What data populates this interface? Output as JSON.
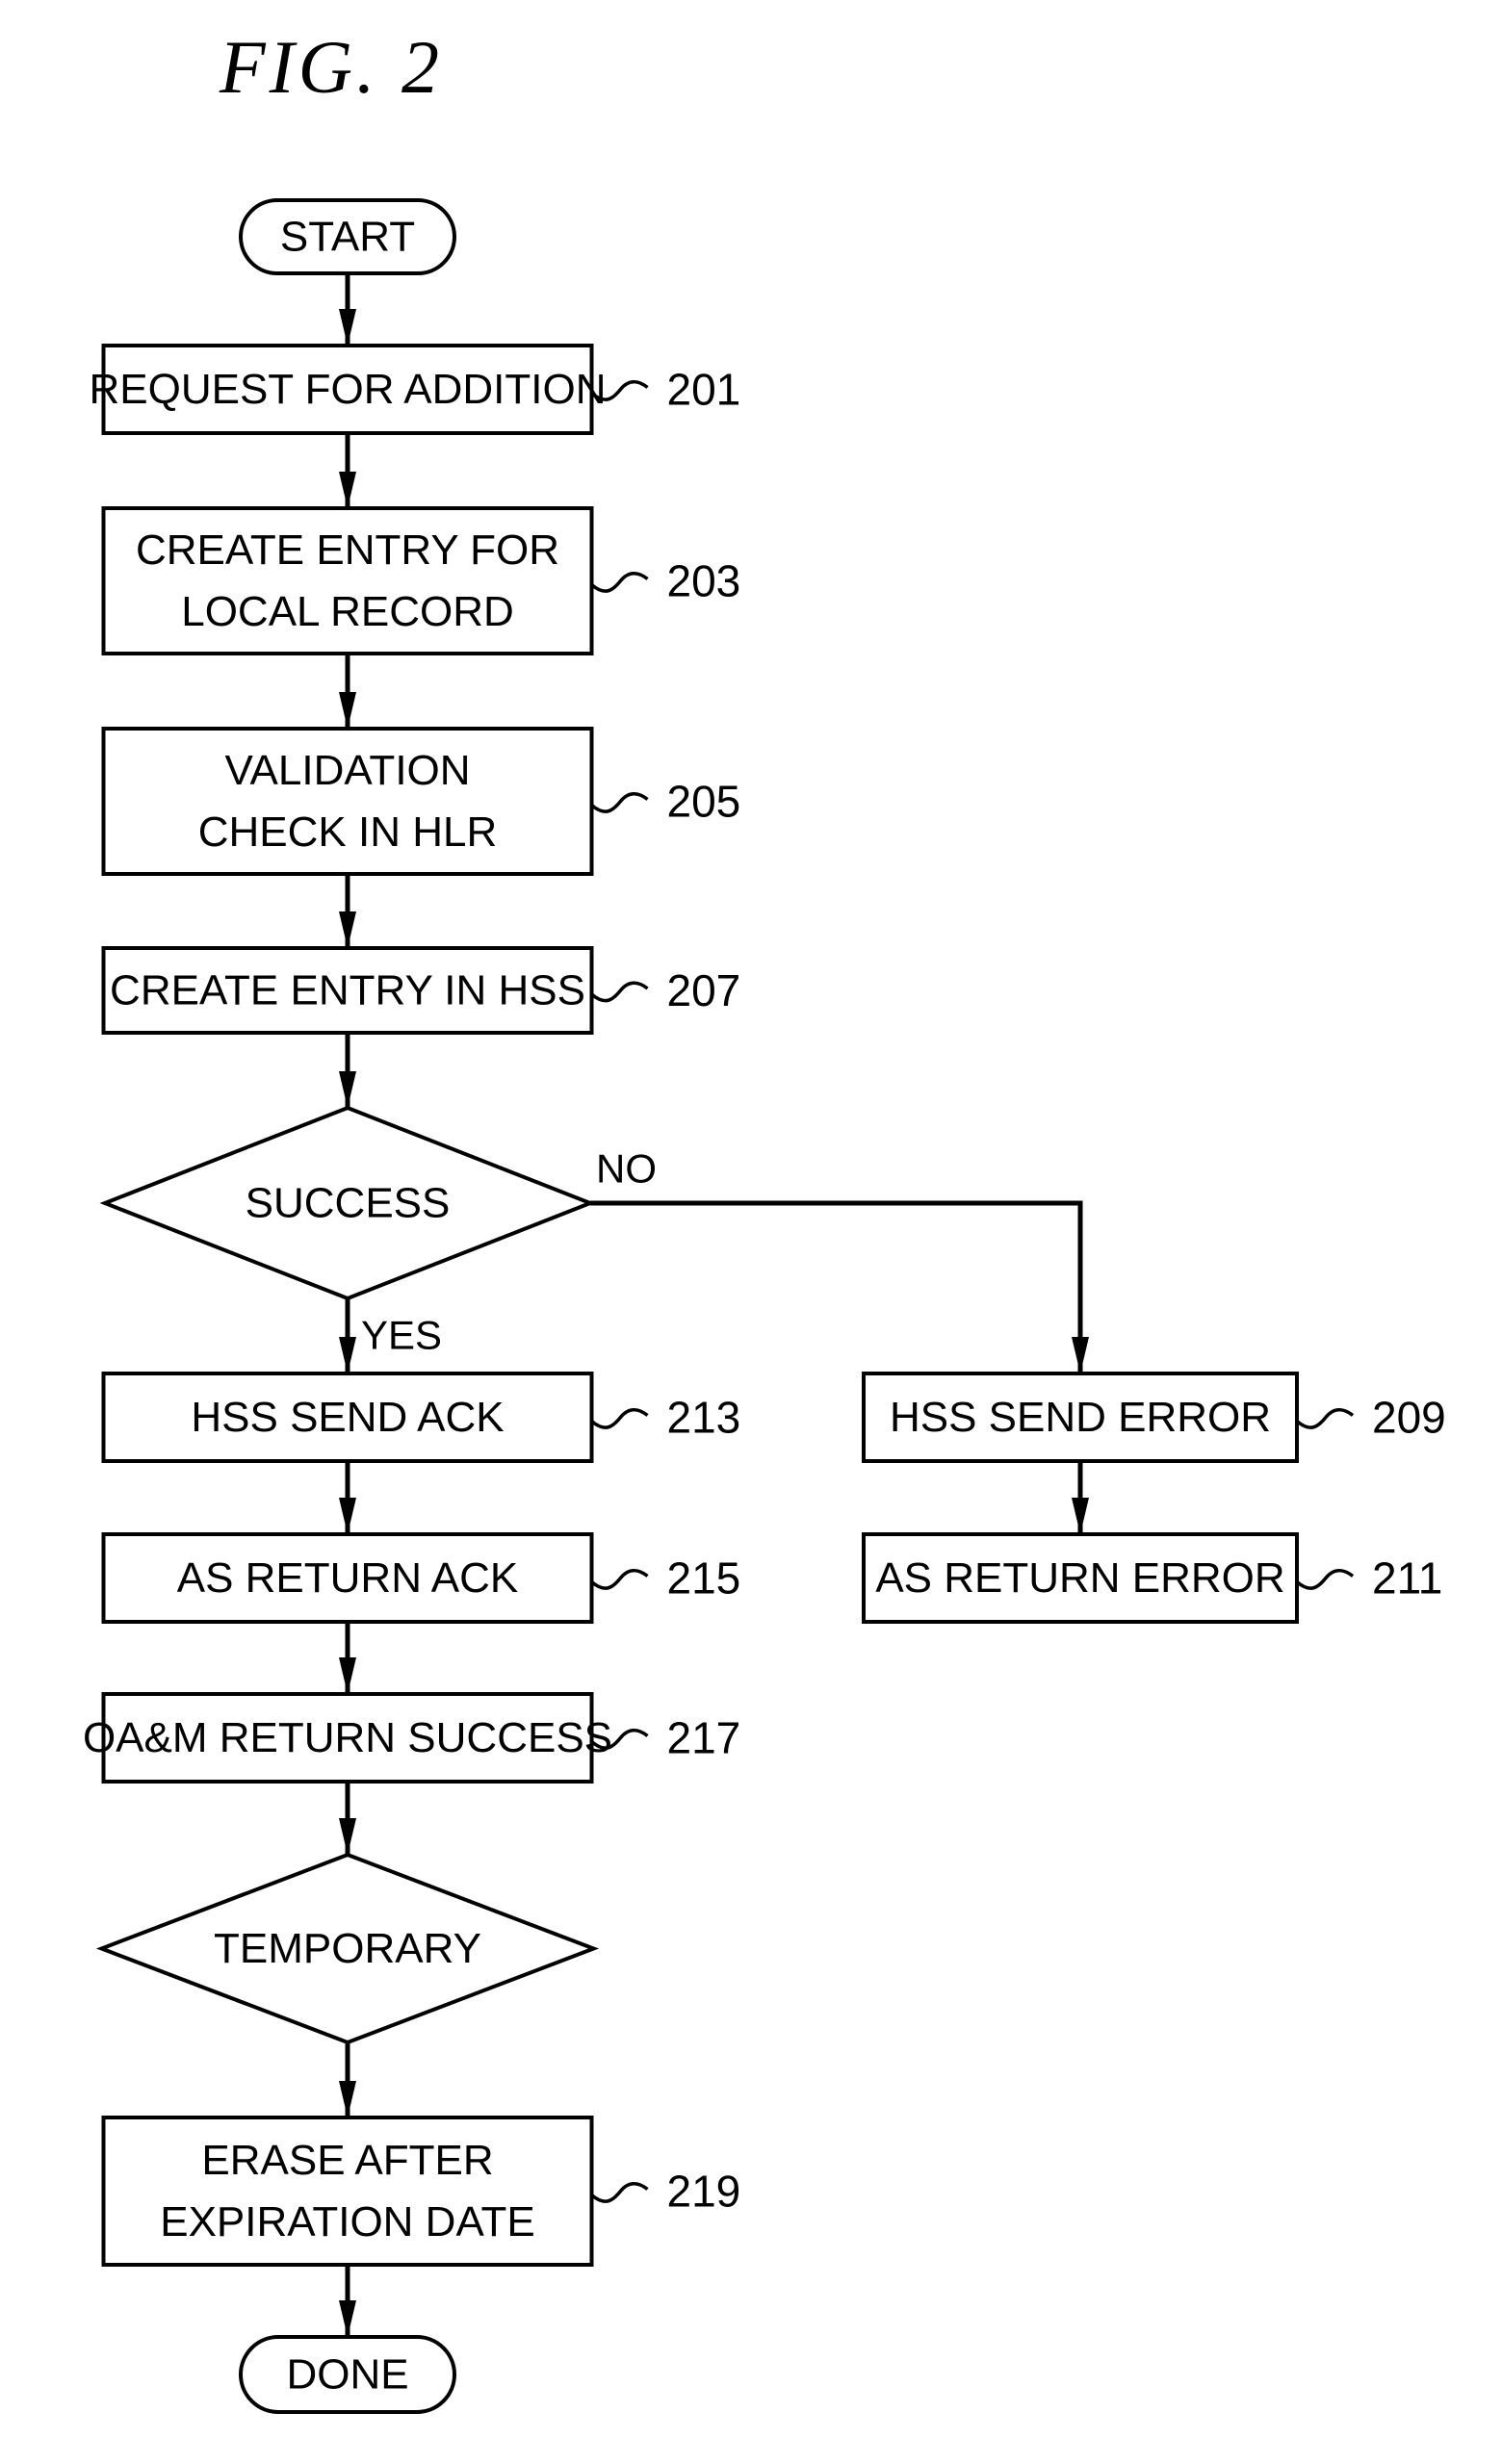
{
  "figure": {
    "title": "FIG. 2"
  },
  "nodes": [
    {
      "id": "start",
      "type": "terminal",
      "lines": [
        "START"
      ],
      "ref": ""
    },
    {
      "id": "n201",
      "type": "process",
      "lines": [
        "REQUEST FOR ADDITION"
      ],
      "ref": "201"
    },
    {
      "id": "n203",
      "type": "process",
      "lines": [
        "CREATE ENTRY FOR",
        "LOCAL RECORD"
      ],
      "ref": "203"
    },
    {
      "id": "n205",
      "type": "process",
      "lines": [
        "VALIDATION",
        "CHECK IN HLR"
      ],
      "ref": "205"
    },
    {
      "id": "n207",
      "type": "process",
      "lines": [
        "CREATE ENTRY IN HSS"
      ],
      "ref": "207"
    },
    {
      "id": "success",
      "type": "decision",
      "lines": [
        "SUCCESS"
      ],
      "ref": ""
    },
    {
      "id": "n213",
      "type": "process",
      "lines": [
        "HSS SEND ACK"
      ],
      "ref": "213"
    },
    {
      "id": "n209",
      "type": "process",
      "lines": [
        "HSS SEND ERROR"
      ],
      "ref": "209"
    },
    {
      "id": "n215",
      "type": "process",
      "lines": [
        "AS RETURN ACK"
      ],
      "ref": "215"
    },
    {
      "id": "n211",
      "type": "process",
      "lines": [
        "AS RETURN ERROR"
      ],
      "ref": "211"
    },
    {
      "id": "n217",
      "type": "process",
      "lines": [
        "OA&M RETURN SUCCESS"
      ],
      "ref": "217"
    },
    {
      "id": "temporary",
      "type": "decision",
      "lines": [
        "TEMPORARY"
      ],
      "ref": ""
    },
    {
      "id": "n219",
      "type": "process",
      "lines": [
        "ERASE AFTER",
        "EXPIRATION DATE"
      ],
      "ref": "219"
    },
    {
      "id": "done",
      "type": "terminal",
      "lines": [
        "DONE"
      ],
      "ref": ""
    }
  ],
  "edges": [
    {
      "from": "start",
      "to": "n201",
      "label": ""
    },
    {
      "from": "n201",
      "to": "n203",
      "label": ""
    },
    {
      "from": "n203",
      "to": "n205",
      "label": ""
    },
    {
      "from": "n205",
      "to": "n207",
      "label": ""
    },
    {
      "from": "n207",
      "to": "success",
      "label": ""
    },
    {
      "from": "success",
      "to": "n213",
      "label": "YES"
    },
    {
      "from": "success",
      "to": "n209",
      "label": "NO"
    },
    {
      "from": "n209",
      "to": "n211",
      "label": ""
    },
    {
      "from": "n213",
      "to": "n215",
      "label": ""
    },
    {
      "from": "n215",
      "to": "n217",
      "label": ""
    },
    {
      "from": "n217",
      "to": "temporary",
      "label": ""
    },
    {
      "from": "temporary",
      "to": "n219",
      "label": ""
    },
    {
      "from": "n219",
      "to": "done",
      "label": ""
    }
  ]
}
